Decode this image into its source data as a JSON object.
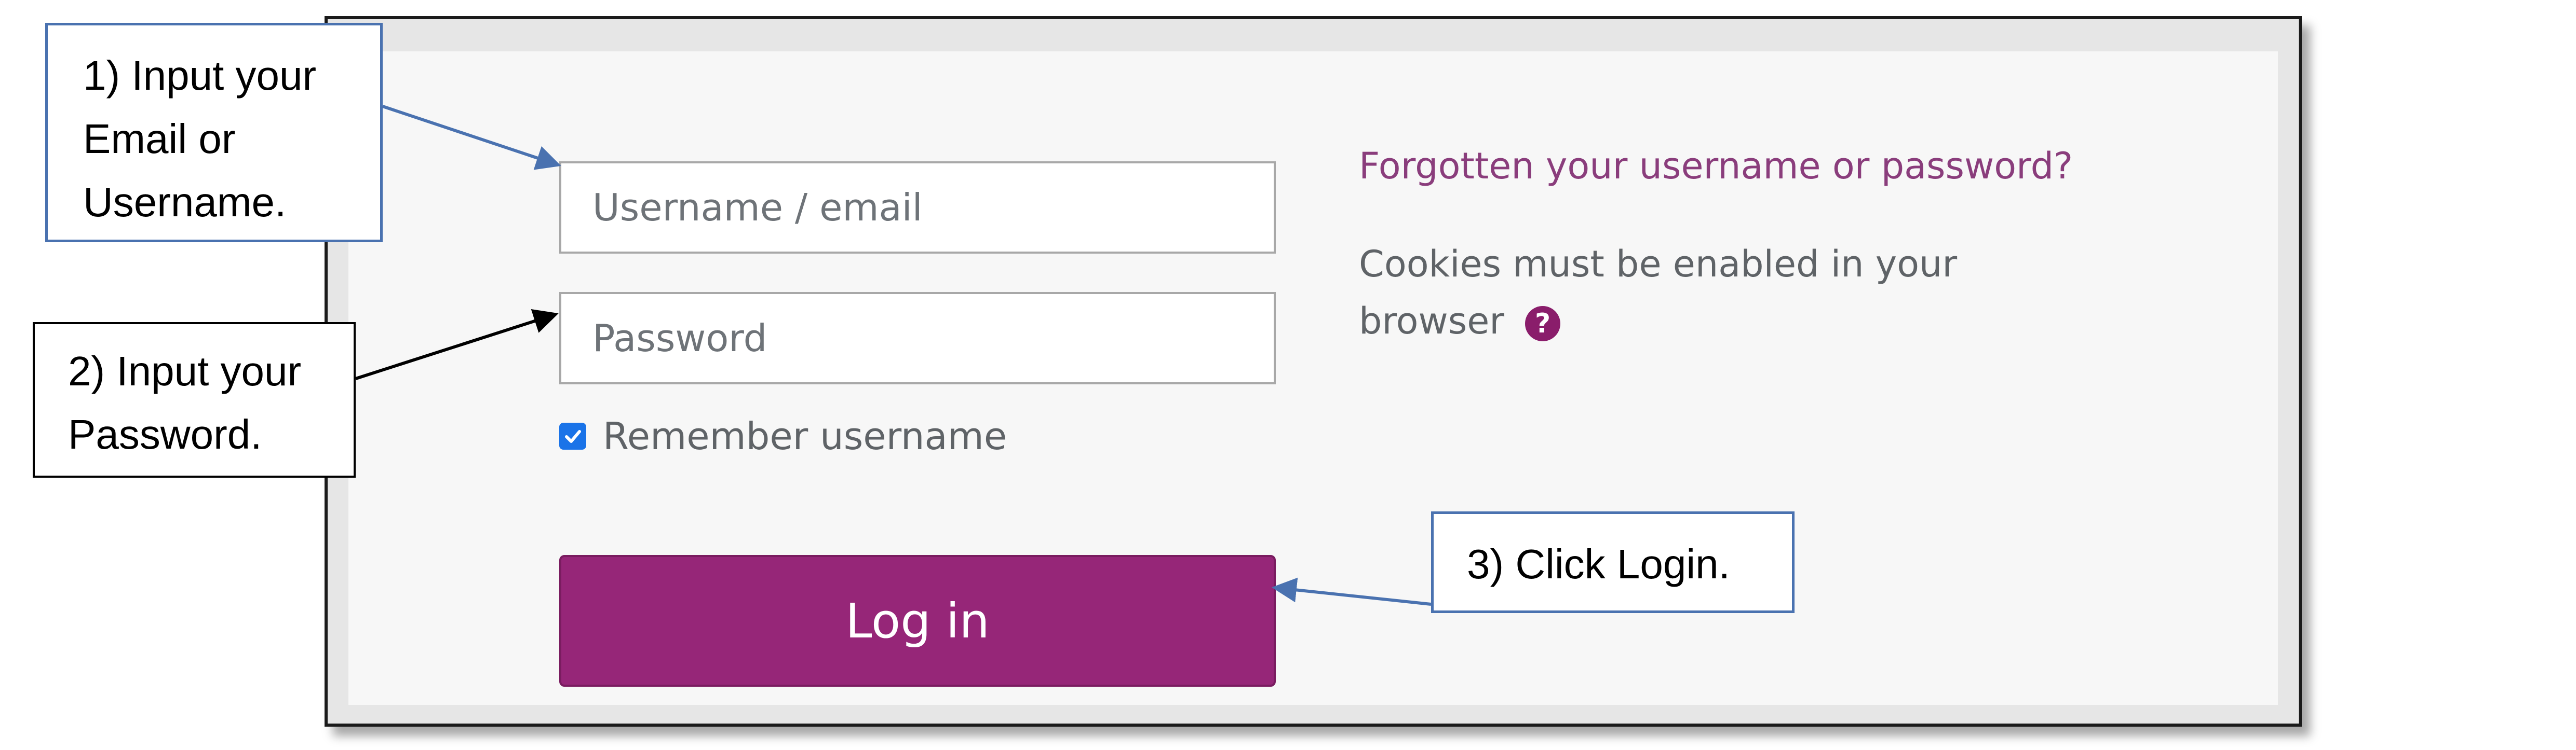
{
  "login_form": {
    "username_placeholder": "Username / email",
    "password_placeholder": "Password",
    "remember_label": "Remember username",
    "remember_checked": true,
    "login_button_label": "Log in",
    "forgot_link": "Forgotten your username or password?",
    "cookies_notice": "Cookies must be enabled in your browser",
    "help_icon_glyph": "?"
  },
  "callouts": {
    "step1_lines": [
      "1) Input your",
      "Email or",
      "Username."
    ],
    "step2_lines": [
      "2) Input your",
      "Password."
    ],
    "step3": "3) Click Login."
  },
  "colors": {
    "login_button": "#962678",
    "link": "#8a3d7c",
    "help_icon": "#8a1d6b",
    "checkbox": "#1a73e8",
    "callout_border_blue": "#4a72b0",
    "arrow_blue": "#4a72b0",
    "arrow_black": "#000000"
  },
  "icons": {
    "checkbox": "check-icon",
    "help": "question-circle-icon",
    "arrows": [
      "arrow-to-username",
      "arrow-to-password",
      "arrow-to-login"
    ]
  }
}
